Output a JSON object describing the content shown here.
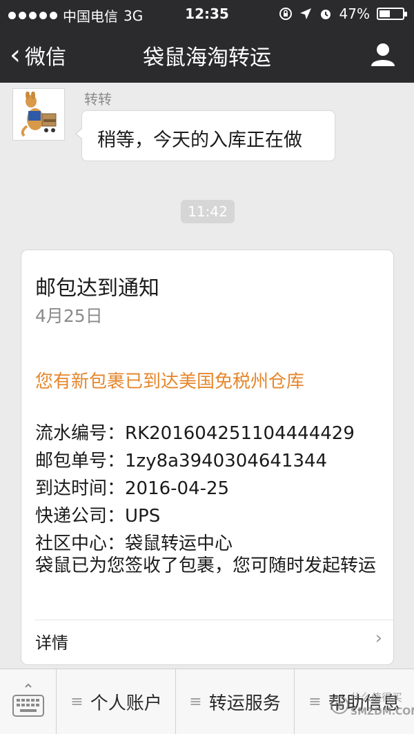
{
  "status_bar": {
    "carrier": "中国电信",
    "network": "3G",
    "time": "12:35",
    "battery_text": "47%",
    "battery_level": 0.47
  },
  "nav": {
    "back_label": "微信",
    "title": "袋鼠海淘转运"
  },
  "chat": {
    "sender_name": "转转",
    "message_text": "稍等，今天的入库正在做",
    "timestamp": "11:42"
  },
  "card": {
    "title": "邮包达到通知",
    "date": "4月25日",
    "notice": "您有新包裹已到达美国免税州仓库",
    "fields": [
      "流水编号：RK201604251104444429",
      "邮包单号：1zy8a3940304641344",
      "到达时间：2016-04-25",
      "快递公司：UPS",
      "社区中心：袋鼠转运中心"
    ],
    "note": "袋鼠已为您签收了包裹，您可随时发起转运",
    "detail_label": "详情"
  },
  "menu": {
    "items": [
      "个人账户",
      "转运服务",
      "帮助信息"
    ]
  },
  "watermark": {
    "line1": "什么值得买",
    "line2": "SMZDM.COM"
  },
  "colors": {
    "topbar_bg": "#2b2b2e",
    "chat_bg": "#ebebeb",
    "notice_orange": "#e6862b"
  }
}
